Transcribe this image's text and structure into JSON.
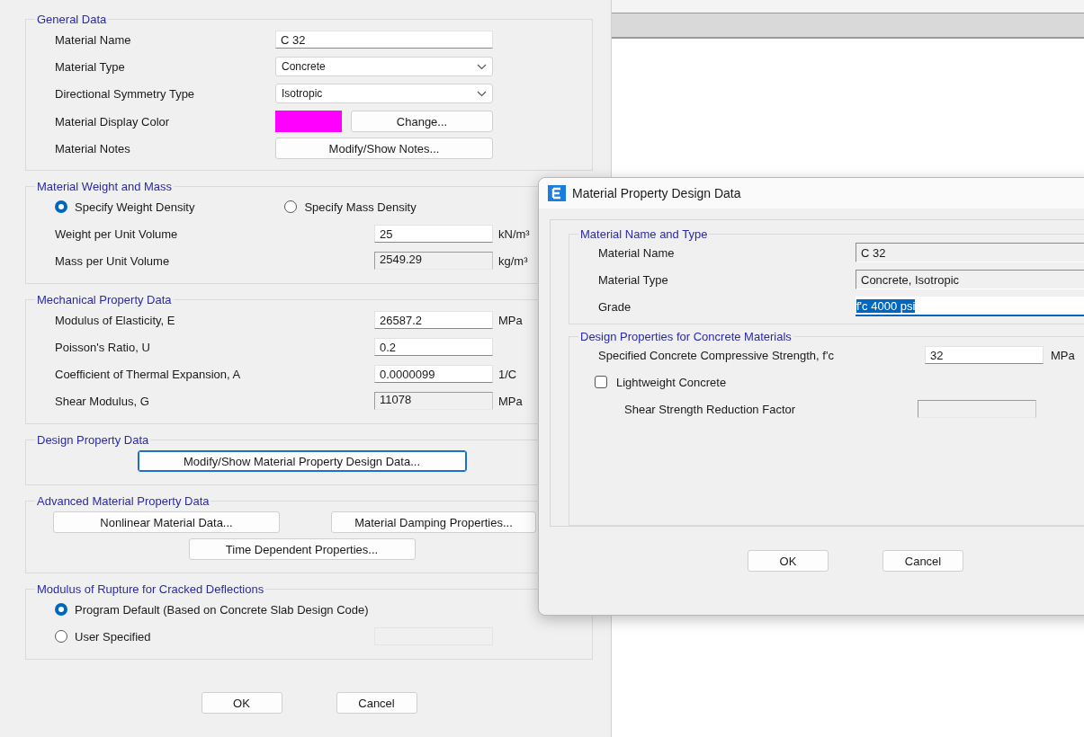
{
  "main_dialog": {
    "general": {
      "title": "General Data",
      "rows": [
        {
          "kind": "text",
          "label": "Material Name",
          "value": "C 32"
        },
        {
          "kind": "select",
          "label": "Material Type",
          "value": "Concrete"
        },
        {
          "kind": "select",
          "label": "Directional Symmetry Type",
          "value": "Isotropic"
        },
        {
          "kind": "color",
          "label": "Material Display Color",
          "color": "#ff00ff",
          "button": "Change..."
        },
        {
          "kind": "button",
          "label": "Material Notes",
          "button": "Modify/Show Notes..."
        }
      ]
    },
    "weight": {
      "title": "Material Weight and Mass",
      "options": [
        {
          "label": "Specify Weight Density",
          "selected": true
        },
        {
          "label": "Specify Mass Density",
          "selected": false
        }
      ],
      "rows": [
        {
          "label": "Weight per Unit Volume",
          "value": "25",
          "unit": "kN/m³",
          "disabled": false
        },
        {
          "label": "Mass per Unit Volume",
          "value": "2549.29",
          "unit": "kg/m³",
          "disabled": true
        }
      ]
    },
    "mechanical": {
      "title": "Mechanical Property Data",
      "rows": [
        {
          "label": "Modulus of Elasticity,  E",
          "value": "26587.2",
          "unit": "MPa",
          "disabled": false
        },
        {
          "label": "Poisson's Ratio,  U",
          "value": "0.2",
          "disabled": false
        },
        {
          "label": "Coefficient of Thermal Expansion,  A",
          "value": "0.0000099",
          "unit": "1/C",
          "disabled": false
        },
        {
          "label": "Shear Modulus,  G",
          "value": "11078",
          "unit": "MPa",
          "disabled": true
        }
      ]
    },
    "design": {
      "title": "Design Property Data",
      "button": "Modify/Show Material Property Design Data...",
      "focused": true
    },
    "advanced": {
      "title": "Advanced Material Property Data",
      "buttons": [
        "Nonlinear Material Data...",
        "Material Damping Properties...",
        "Time Dependent Properties..."
      ]
    },
    "rupture": {
      "title": "Modulus of Rupture for Cracked Deflections",
      "options": [
        {
          "label": "Program Default  (Based on Concrete Slab Design Code)",
          "selected": true
        },
        {
          "label": "User Specified",
          "selected": false,
          "field": true
        }
      ]
    },
    "buttons": [
      "OK",
      "Cancel"
    ]
  },
  "design_dialog": {
    "title": "Material Property Design Data",
    "name_type": {
      "title": "Material Name and Type",
      "rows": [
        {
          "label": "Material Name",
          "value": "C 32",
          "kind": "readonly"
        },
        {
          "label": "Material Type",
          "value": "Concrete, Isotropic",
          "kind": "readonly"
        },
        {
          "label": "Grade",
          "value": "f'c 4000 psi",
          "kind": "edit",
          "highlighted": true
        }
      ]
    },
    "concrete": {
      "title": "Design Properties for Concrete Materials",
      "strength": {
        "label": "Specified Concrete Compressive Strength, f'c",
        "value": "32",
        "unit": "MPa"
      },
      "lightweight": {
        "label": "Lightweight Concrete",
        "checked": false
      },
      "reduction": {
        "label": "Shear Strength Reduction Factor",
        "disabled": true
      }
    },
    "buttons": [
      "OK",
      "Cancel"
    ]
  }
}
